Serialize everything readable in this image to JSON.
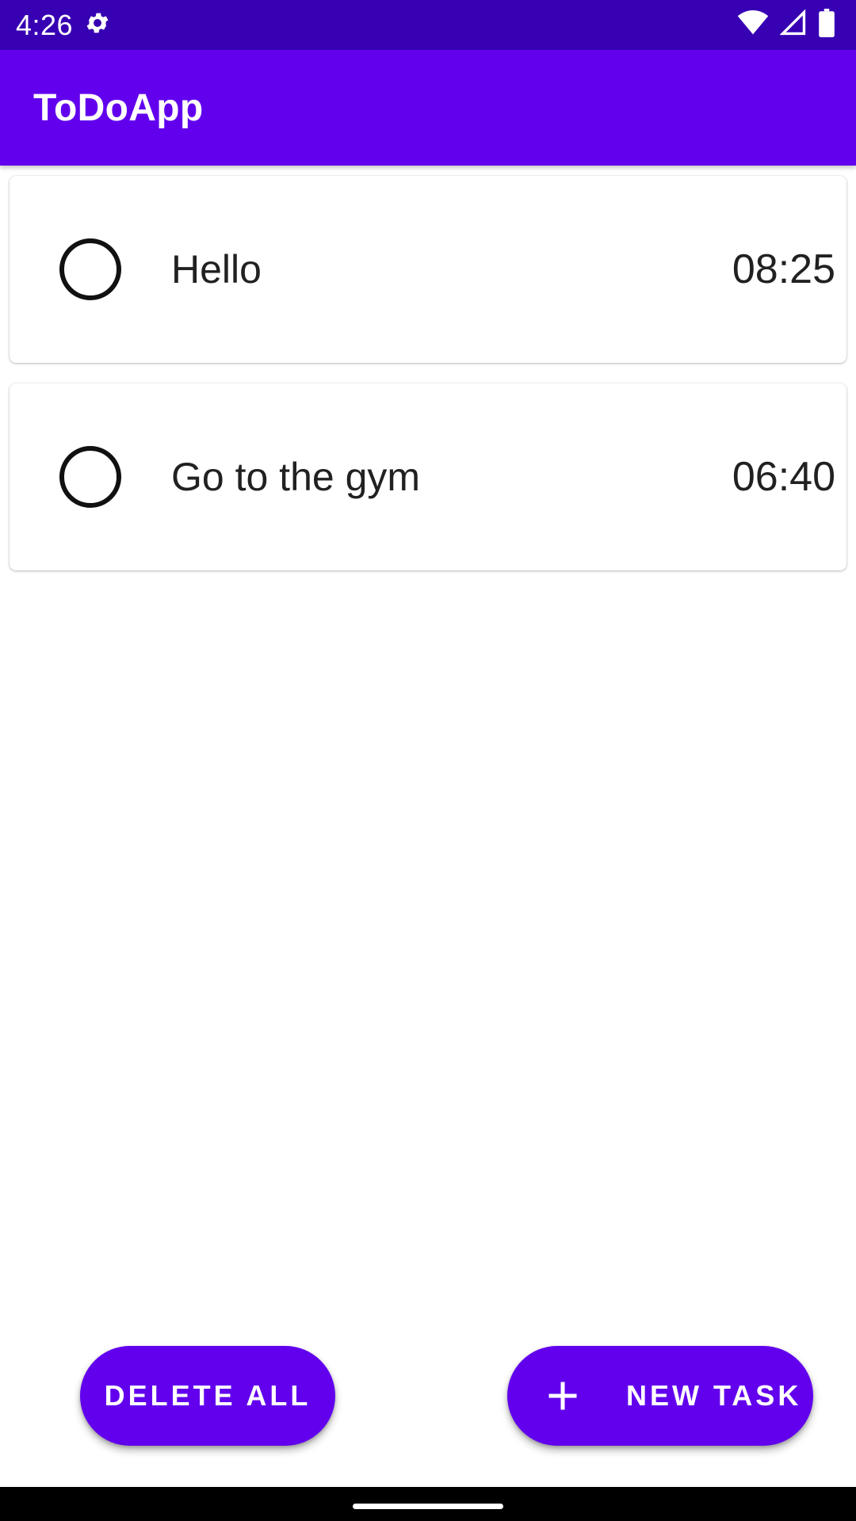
{
  "status_bar": {
    "time": "4:26",
    "icons": [
      "gear-icon",
      "wifi-icon",
      "signal-icon",
      "battery-icon"
    ],
    "color": "#3700b3"
  },
  "app_bar": {
    "title": "ToDoApp",
    "color": "#6200ee"
  },
  "tasks": [
    {
      "title": "Hello",
      "time": "08:25",
      "completed": false
    },
    {
      "title": "Go to the gym",
      "time": "06:40",
      "completed": false
    }
  ],
  "actions": {
    "delete_all_label": "DELETE ALL",
    "new_task_label": "NEW TASK",
    "new_task_icon": "plus-icon"
  },
  "accent_color": "#6200ee"
}
